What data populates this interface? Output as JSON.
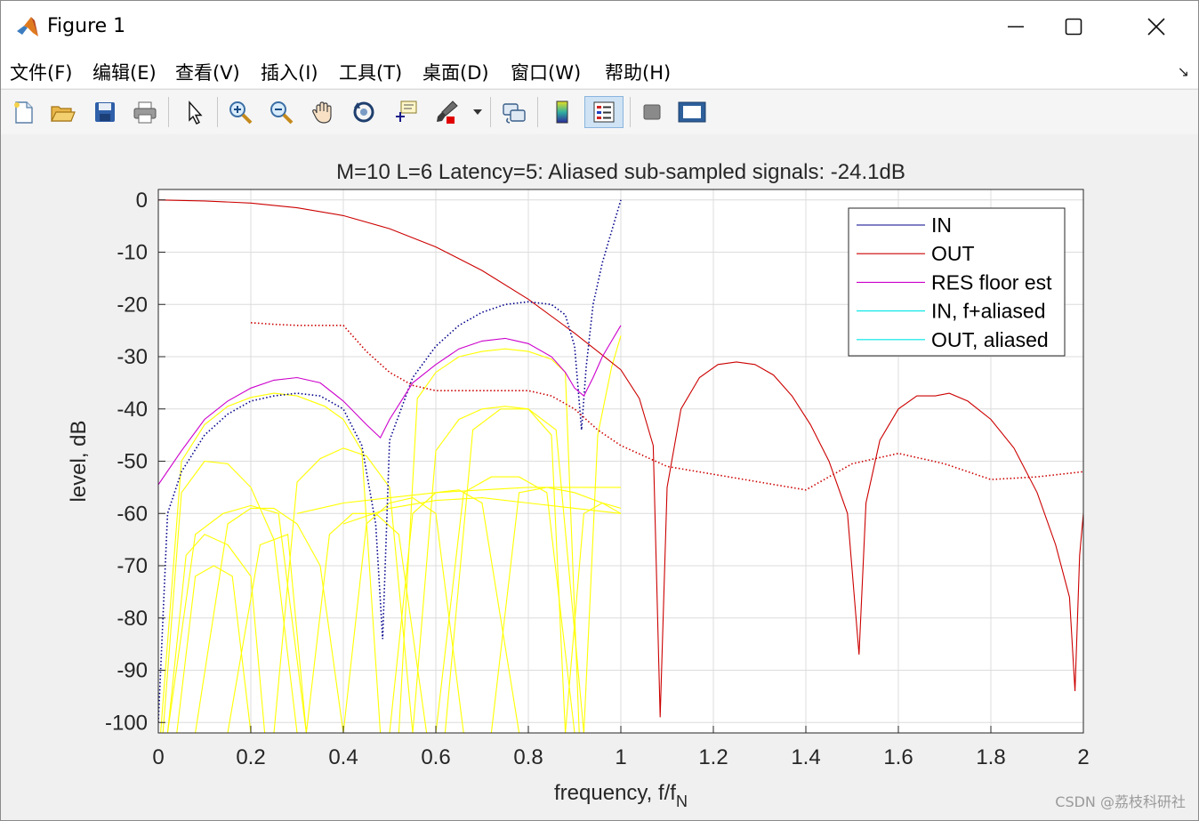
{
  "window": {
    "title": "Figure 1",
    "icon": "matlab-logo-icon",
    "controls": [
      "minimize-icon",
      "maximize-icon",
      "close-icon"
    ]
  },
  "menu": [
    "文件(F)",
    "编辑(E)",
    "查看(V)",
    "插入(I)",
    "工具(T)",
    "桌面(D)",
    "窗口(W)",
    "帮助(H)"
  ],
  "menu_arrow": "↘",
  "toolbar": [
    "new-figure-icon",
    "open-icon",
    "save-icon",
    "print-icon",
    "pointer-icon",
    "zoom-in-icon",
    "zoom-out-icon",
    "pan-icon",
    "rotate-icon",
    "data-cursor-icon",
    "brush-icon",
    "link-icon",
    "colorbar-icon",
    "legend-icon",
    "hide-plot-tools-icon",
    "show-plot-tools-icon"
  ],
  "colors": {
    "IN": "#00008b",
    "OUT": "#cc0000",
    "RES floor est": "#cc00cc",
    "IN, f+aliased": "#00e5e5",
    "OUT, aliased": "#00e5e5",
    "aliased_components": "#ffff00",
    "floor_dotted": "#cc0000"
  },
  "watermark": "CSDN @荔枝科研社",
  "chart_data": {
    "type": "line",
    "title": "M=10 L=6 Latency=5: Aliased sub-sampled signals: -24.1dB",
    "xlabel": "frequency, f/f",
    "xlabel_sub": "N",
    "ylabel": "level, dB",
    "xlim": [
      0,
      2
    ],
    "ylim": [
      -102,
      2
    ],
    "xticks": [
      "0",
      "0.2",
      "0.4",
      "0.6",
      "0.8",
      "1",
      "1.2",
      "1.4",
      "1.6",
      "1.8",
      "2"
    ],
    "yticks": [
      "0",
      "-10",
      "-20",
      "-30",
      "-40",
      "-50",
      "-60",
      "-70",
      "-80",
      "-90",
      "-100"
    ],
    "grid": true,
    "legend_position": "top-right",
    "legend": [
      "IN",
      "OUT",
      "RES floor est",
      "IN, f+aliased",
      "OUT, aliased"
    ],
    "series": [
      {
        "name": "OUT",
        "style": "solid",
        "x": [
          0,
          0.1,
          0.2,
          0.3,
          0.4,
          0.5,
          0.6,
          0.7,
          0.8,
          0.9,
          0.95,
          1.0,
          1.04,
          1.07,
          1.085,
          1.1,
          1.13,
          1.17,
          1.21,
          1.25,
          1.29,
          1.33,
          1.37,
          1.41,
          1.45,
          1.49,
          1.515,
          1.53,
          1.56,
          1.6,
          1.64,
          1.68,
          1.71,
          1.75,
          1.8,
          1.85,
          1.9,
          1.94,
          1.97,
          1.982,
          1.992,
          2.0
        ],
        "y": [
          0,
          -0.2,
          -0.6,
          -1.5,
          -3,
          -5.5,
          -9,
          -13.5,
          -19,
          -25.5,
          -29,
          -32.5,
          -38,
          -47,
          -99,
          -55,
          -40,
          -34,
          -31.5,
          -31,
          -31.5,
          -33.5,
          -37.5,
          -43,
          -50,
          -60,
          -87,
          -58,
          -46,
          -40,
          -37.5,
          -37.5,
          -37,
          -38.5,
          -42,
          -47.5,
          -56,
          -66,
          -76,
          -94,
          -68,
          -60
        ]
      },
      {
        "name": "IN",
        "style": "dotted",
        "x": [
          0,
          0.02,
          0.05,
          0.1,
          0.15,
          0.2,
          0.25,
          0.3,
          0.35,
          0.4,
          0.44,
          0.47,
          0.485,
          0.5,
          0.55,
          0.6,
          0.65,
          0.7,
          0.75,
          0.8,
          0.85,
          0.88,
          0.9,
          0.915,
          0.925,
          0.94,
          0.96,
          0.98,
          1.0
        ],
        "y": [
          -100,
          -60,
          -52,
          -45,
          -41,
          -38.5,
          -37.5,
          -37,
          -37.5,
          -40,
          -47,
          -62,
          -84,
          -46,
          -34,
          -28,
          -24,
          -21.5,
          -20,
          -19.5,
          -20,
          -22,
          -28,
          -44,
          -32,
          -20,
          -12,
          -6,
          0
        ]
      },
      {
        "name": "RES floor est",
        "style": "solid",
        "x": [
          0,
          0.05,
          0.1,
          0.15,
          0.2,
          0.25,
          0.3,
          0.35,
          0.4,
          0.45,
          0.48,
          0.5,
          0.55,
          0.6,
          0.65,
          0.7,
          0.75,
          0.8,
          0.85,
          0.88,
          0.9,
          0.92,
          0.94,
          0.96,
          0.98,
          1.0
        ],
        "y": [
          -54.5,
          -48,
          -42,
          -38.5,
          -36,
          -34.5,
          -34,
          -35,
          -38.5,
          -43,
          -45.5,
          -42,
          -35,
          -31.5,
          -28.5,
          -27,
          -26.5,
          -27.5,
          -30,
          -33,
          -36,
          -37.5,
          -34,
          -30,
          -27,
          -24
        ]
      },
      {
        "name": "floor_dotted",
        "style": "dotted",
        "x": [
          0.2,
          0.25,
          0.3,
          0.35,
          0.4,
          0.45,
          0.5,
          0.55,
          0.6,
          0.65,
          0.7,
          0.75,
          0.8,
          0.85,
          0.9,
          0.95,
          1.0,
          1.05,
          1.1,
          1.2,
          1.3,
          1.4,
          1.5,
          1.6,
          1.7,
          1.8,
          1.9,
          2.0
        ],
        "y": [
          -23.5,
          -23.8,
          -24,
          -24,
          -24,
          -29,
          -33,
          -35.5,
          -36.5,
          -36.5,
          -36.5,
          -36.5,
          -36.5,
          -37.5,
          -40,
          -44,
          -47,
          -49,
          -51,
          -52.5,
          -54,
          -55.5,
          -50.5,
          -48.5,
          -50.5,
          -53.5,
          -53,
          -52
        ]
      },
      {
        "name": "aliased_components",
        "style": "solid",
        "lobes": [
          {
            "x": [
              0.005,
              0.05,
              0.1,
              0.15,
              0.2,
              0.25,
              0.3,
              0.36,
              0.4,
              0.44,
              0.48
            ],
            "y": [
              -102,
              -50,
              -43,
              -39.5,
              -37.8,
              -37,
              -37.5,
              -39.5,
              -42,
              -48,
              -102
            ]
          },
          {
            "x": [
              0.52,
              0.56,
              0.6,
              0.65,
              0.7,
              0.75,
              0.8,
              0.85,
              0.88,
              0.91
            ],
            "y": [
              -102,
              -38,
              -33,
              -30,
              -29,
              -28.5,
              -29,
              -30.5,
              -33,
              -102
            ]
          },
          {
            "x": [
              0.01,
              0.05,
              0.1,
              0.15,
              0.2,
              0.25,
              0.3
            ],
            "y": [
              -102,
              -56,
              -50,
              -50.5,
              -55,
              -65,
              -102
            ]
          },
          {
            "x": [
              0.25,
              0.3,
              0.35,
              0.4,
              0.45,
              0.5,
              0.55
            ],
            "y": [
              -102,
              -54,
              -49.5,
              -47.5,
              -49,
              -55,
              -102
            ]
          },
          {
            "x": [
              0.55,
              0.6,
              0.65,
              0.7,
              0.75,
              0.8,
              0.85,
              0.88
            ],
            "y": [
              -102,
              -48,
              -42,
              -40,
              -39.5,
              -40,
              -45,
              -102
            ]
          },
          {
            "x": [
              0.62,
              0.68,
              0.74,
              0.8,
              0.86,
              0.92
            ],
            "y": [
              -102,
              -44,
              -40,
              -40,
              -44,
              -102
            ]
          },
          {
            "x": [
              0.92,
              0.95,
              0.98,
              1.0
            ],
            "y": [
              -102,
              -45,
              -32,
              -26
            ]
          },
          {
            "x": [
              0.02,
              0.06,
              0.1,
              0.15,
              0.2,
              0.23
            ],
            "y": [
              -102,
              -68,
              -64,
              -66,
              -72,
              -102
            ]
          },
          {
            "x": [
              0.02,
              0.08,
              0.14,
              0.2,
              0.26,
              0.32
            ],
            "y": [
              -102,
              -64,
              -60,
              -58.5,
              -60,
              -102
            ]
          },
          {
            "x": [
              0.08,
              0.15,
              0.2,
              0.25,
              0.3,
              0.35,
              0.4
            ],
            "y": [
              -102,
              -62,
              -59,
              -59,
              -62,
              -70,
              -102
            ]
          },
          {
            "x": [
              0.15,
              0.22,
              0.28,
              0.32
            ],
            "y": [
              -102,
              -66,
              -64,
              -102
            ]
          },
          {
            "x": [
              0.32,
              0.37,
              0.42,
              0.47,
              0.52,
              0.58
            ],
            "y": [
              -102,
              -64,
              -60,
              -60,
              -64,
              -102
            ]
          },
          {
            "x": [
              0.4,
              0.45,
              0.5,
              0.55,
              0.6,
              0.66
            ],
            "y": [
              -102,
              -62,
              -58,
              -57,
              -60,
              -102
            ]
          },
          {
            "x": [
              0.5,
              0.55,
              0.6,
              0.65,
              0.7,
              0.78
            ],
            "y": [
              -102,
              -60,
              -56,
              -55.5,
              -58,
              -102
            ]
          },
          {
            "x": [
              0.6,
              0.66,
              0.72,
              0.78,
              0.84,
              0.9
            ],
            "y": [
              -102,
              -56,
              -53,
              -53,
              -56,
              -102
            ]
          },
          {
            "x": [
              0.72,
              0.78,
              0.84,
              0.9,
              0.96,
              1.0
            ],
            "y": [
              -102,
              -56,
              -55,
              -56,
              -58,
              -60
            ]
          },
          {
            "x": [
              0.3,
              0.4,
              0.5,
              0.6,
              0.7,
              0.8,
              0.9,
              1.0
            ],
            "y": [
              -60,
              -58,
              -57,
              -56,
              -55.5,
              -55,
              -55,
              -55
            ]
          },
          {
            "x": [
              0.4,
              0.5,
              0.6,
              0.7,
              0.8,
              0.9,
              1.0
            ],
            "y": [
              -62,
              -59,
              -57.5,
              -57,
              -58,
              -59,
              -60
            ]
          },
          {
            "x": [
              0.04,
              0.08,
              0.12,
              0.16,
              0.2
            ],
            "y": [
              -102,
              -72,
              -70,
              -72,
              -102
            ]
          },
          {
            "x": [
              0.88,
              0.92,
              0.96,
              1.0
            ],
            "y": [
              -102,
              -60,
              -58,
              -59
            ]
          }
        ]
      }
    ]
  }
}
